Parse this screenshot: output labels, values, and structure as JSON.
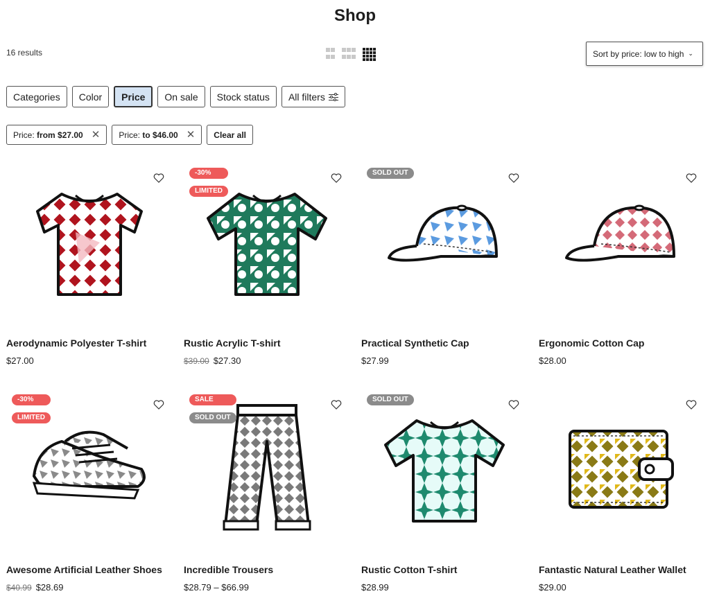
{
  "page": {
    "title": "Shop"
  },
  "toolbar": {
    "results": "16 results",
    "sort_label": "Sort by price: low to high"
  },
  "filters": [
    "Categories",
    "Color",
    "Price",
    "On sale",
    "Stock status",
    "All filters"
  ],
  "active_filters": {
    "from_prefix": "Price: ",
    "from_value": "from $27.00",
    "to_prefix": "Price: ",
    "to_value": "to $46.00",
    "clear": "Clear all"
  },
  "products": [
    {
      "name": "Aerodynamic Polyester T-shirt",
      "price": "$27.00",
      "old_price": "",
      "badges": []
    },
    {
      "name": "Rustic Acrylic T-shirt",
      "price": "$27.30",
      "old_price": "$39.00",
      "badges": [
        "-30%",
        "LIMITED"
      ]
    },
    {
      "name": "Practical Synthetic Cap",
      "price": "$27.99",
      "old_price": "",
      "badges": [
        "SOLD OUT"
      ]
    },
    {
      "name": "Ergonomic Cotton Cap",
      "price": "$28.00",
      "old_price": "",
      "badges": []
    },
    {
      "name": "Awesome Artificial Leather Shoes",
      "price": "$28.69",
      "old_price": "$40.99",
      "badges": [
        "-30%",
        "LIMITED"
      ]
    },
    {
      "name": "Incredible Trousers",
      "price": "$28.79 – $66.99",
      "old_price": "",
      "badges": [
        "SALE",
        "SOLD OUT"
      ]
    },
    {
      "name": "Rustic Cotton T-shirt",
      "price": "$28.99",
      "old_price": "",
      "badges": [
        "SOLD OUT"
      ]
    },
    {
      "name": "Fantastic Natural Leather Wallet",
      "price": "$29.00",
      "old_price": "",
      "badges": []
    }
  ],
  "colors": {
    "sale_badge": "#ee5a5a",
    "sold_badge": "#8b8b8b",
    "active_filter_bg": "#d4e3f3",
    "tshirt_red": "#b0141e",
    "tshirt_green": "#1f7a5c",
    "cap_blue": "#5b9be0",
    "cap_red": "#d46a78",
    "shoe_gray": "#8a8a8a",
    "trouser_gray": "#7a7a7a",
    "tshirt_teal": "#1e8a6e",
    "wallet_olive": "#8a7a16"
  },
  "icons": [
    "grid-2-icon",
    "grid-3-icon",
    "grid-4-icon",
    "chevron-down-icon",
    "sliders-icon",
    "close-icon",
    "heart-icon"
  ]
}
